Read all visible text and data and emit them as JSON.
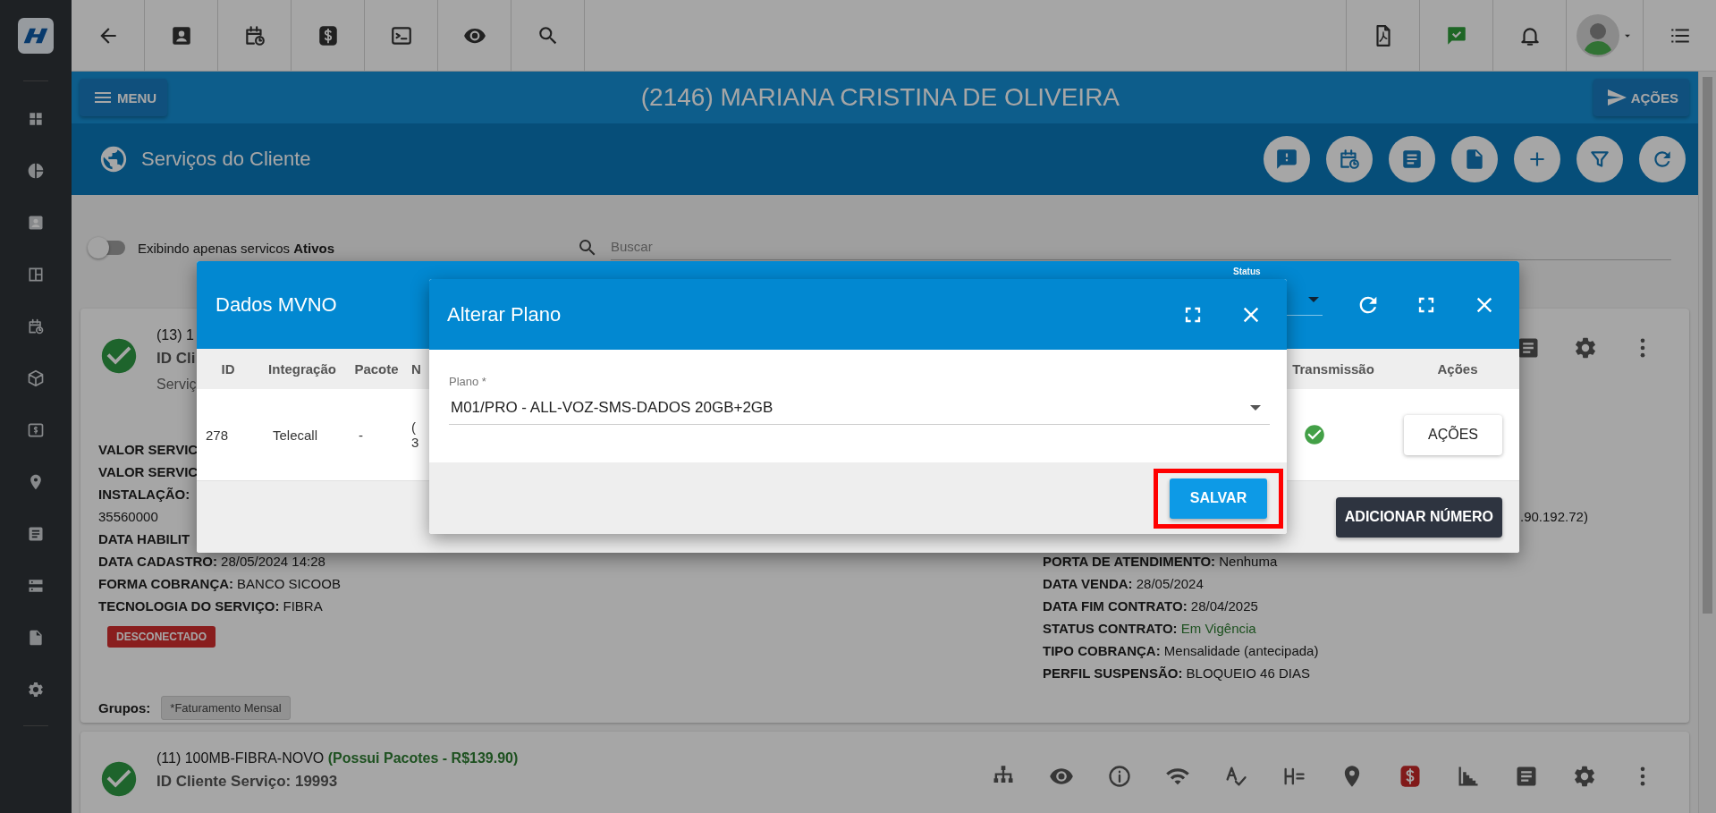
{
  "header": {
    "menu_button": "MENU",
    "client_title": "(2146) MARIANA CRISTINA DE OLIVEIRA",
    "actions_button": "AÇÕES"
  },
  "section": {
    "title": "Serviços do Cliente"
  },
  "filter": {
    "toggle": {
      "on": false,
      "label": "Exibindo apenas servicos **Ativos**"
    },
    "search": {
      "placeholder": "Buscar"
    }
  },
  "services": [
    {
      "title": "(13) 1",
      "id_line": "ID Cli",
      "subtitle": "Serviç",
      "details_left": [
        {
          "label": "VALOR SERVIC"
        },
        {
          "label": "VALOR SERVIC"
        },
        {
          "label": "INSTALAÇÃO:"
        },
        {
          "value": "35560000"
        },
        {
          "label": "DATA HABILIT"
        },
        {
          "label": "DATA CADASTRO:",
          "value": "28/05/2024 14:28"
        },
        {
          "label": "FORMA COBRANÇA:",
          "value": "BANCO SICOOB"
        },
        {
          "label": "TECNOLOGIA DO SERVIÇO:",
          "value": "FIBRA"
        }
      ],
      "ip_fragment": ".90.192.72)",
      "details_right": [
        {
          "label": "PORTA DE ATENDIMENTO:",
          "value": "Nenhuma",
          "kind": "plain"
        },
        {
          "label": "DATA VENDA:",
          "value": "28/05/2024",
          "kind": "plain"
        },
        {
          "label": "DATA FIM CONTRATO:",
          "value": "28/04/2025",
          "kind": "plain"
        },
        {
          "label": "STATUS CONTRATO:",
          "value": "Em Vigência",
          "kind": "status"
        },
        {
          "label": "TIPO COBRANÇA:",
          "value": "Mensalidade (antecipada)",
          "kind": "plain"
        },
        {
          "label": "PERFIL SUSPENSÃO:",
          "value": "BLOQUEIO 46 DIAS",
          "kind": "plain"
        }
      ],
      "badge": "DESCONECTADO",
      "groups_label": "Grupos:",
      "groups": [
        "*Faturamento Mensal"
      ]
    },
    {
      "title": "(11) 100MB-FIBRA-NOVO",
      "title_extra": "(Possui Pacotes - R$139.90)",
      "id_line": "ID Cliente Serviço: 19993"
    }
  ],
  "mvno_modal": {
    "title": "Dados MVNO",
    "status_label": "Status",
    "columns": [
      "ID",
      "Integração",
      "Pacote",
      "N",
      "Transmissão",
      "Ações"
    ],
    "rows": [
      {
        "id": "278",
        "integration": "Telecall",
        "package": "-",
        "column_4": [
          "(",
          "3"
        ],
        "action_button": "AÇÕES"
      }
    ],
    "add_button": "ADICIONAR NÚMERO"
  },
  "plan_modal": {
    "title": "Alterar Plano",
    "field": {
      "label": "Plano *",
      "value": "M01/PRO - ALL-VOZ-SMS-DADOS 20GB+2GB"
    },
    "save_button": "SALVAR",
    "save_highlighted": true
  }
}
